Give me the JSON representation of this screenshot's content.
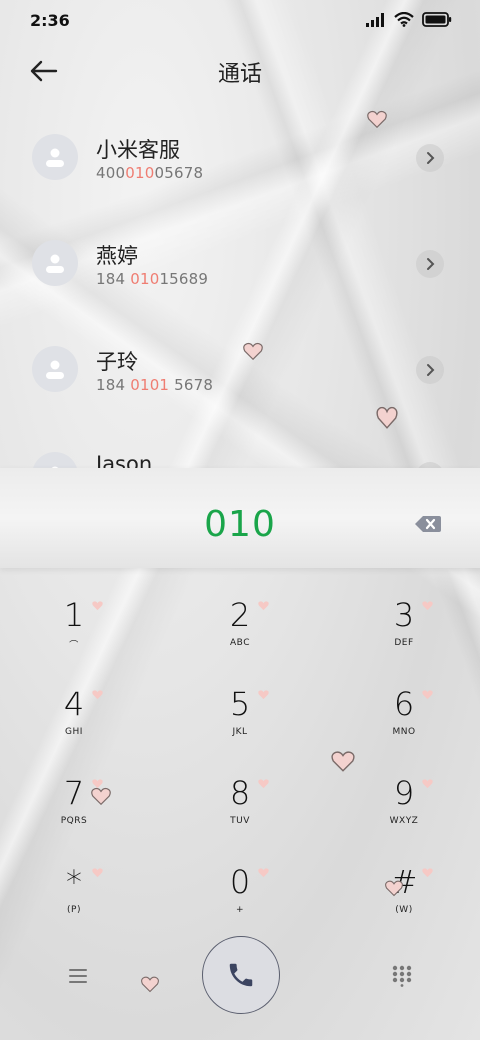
{
  "status": {
    "time": "2:36"
  },
  "header": {
    "title": "通话"
  },
  "contacts": [
    {
      "name": "小米客服",
      "number_pre": "400",
      "number_hl": "010",
      "number_post": "05678"
    },
    {
      "name": "燕婷",
      "number_pre": "184 ",
      "number_hl": "010",
      "number_post": "15689"
    },
    {
      "name": "子玲",
      "number_pre": "184 ",
      "number_hl": "0101",
      "number_post": " 5678"
    },
    {
      "name": "Jason",
      "number_pre": "",
      "number_hl": "",
      "number_post": ""
    }
  ],
  "dialer": {
    "input": "010"
  },
  "keypad": [
    {
      "digit": "1",
      "letters": "⌒"
    },
    {
      "digit": "2",
      "letters": "ABC"
    },
    {
      "digit": "3",
      "letters": "DEF"
    },
    {
      "digit": "4",
      "letters": "GHI"
    },
    {
      "digit": "5",
      "letters": "JKL"
    },
    {
      "digit": "6",
      "letters": "MNO"
    },
    {
      "digit": "7",
      "letters": "PQRS"
    },
    {
      "digit": "8",
      "letters": "TUV"
    },
    {
      "digit": "9",
      "letters": "WXYZ"
    },
    {
      "digit": "*",
      "letters": "(P)"
    },
    {
      "digit": "0",
      "letters": "+"
    },
    {
      "digit": "#",
      "letters": "(W)"
    }
  ],
  "colors": {
    "accent_number": "#1aa54a",
    "highlight": "#ef7d72",
    "heart_fill": "#f6c9c5",
    "heart_stroke": "#7a6a68"
  },
  "icons": {
    "back": "arrow-left-icon",
    "chevron": "chevron-right-icon",
    "backspace": "backspace-icon",
    "menu": "menu-icon",
    "call": "phone-icon",
    "dialpad": "dialpad-grid-icon"
  }
}
